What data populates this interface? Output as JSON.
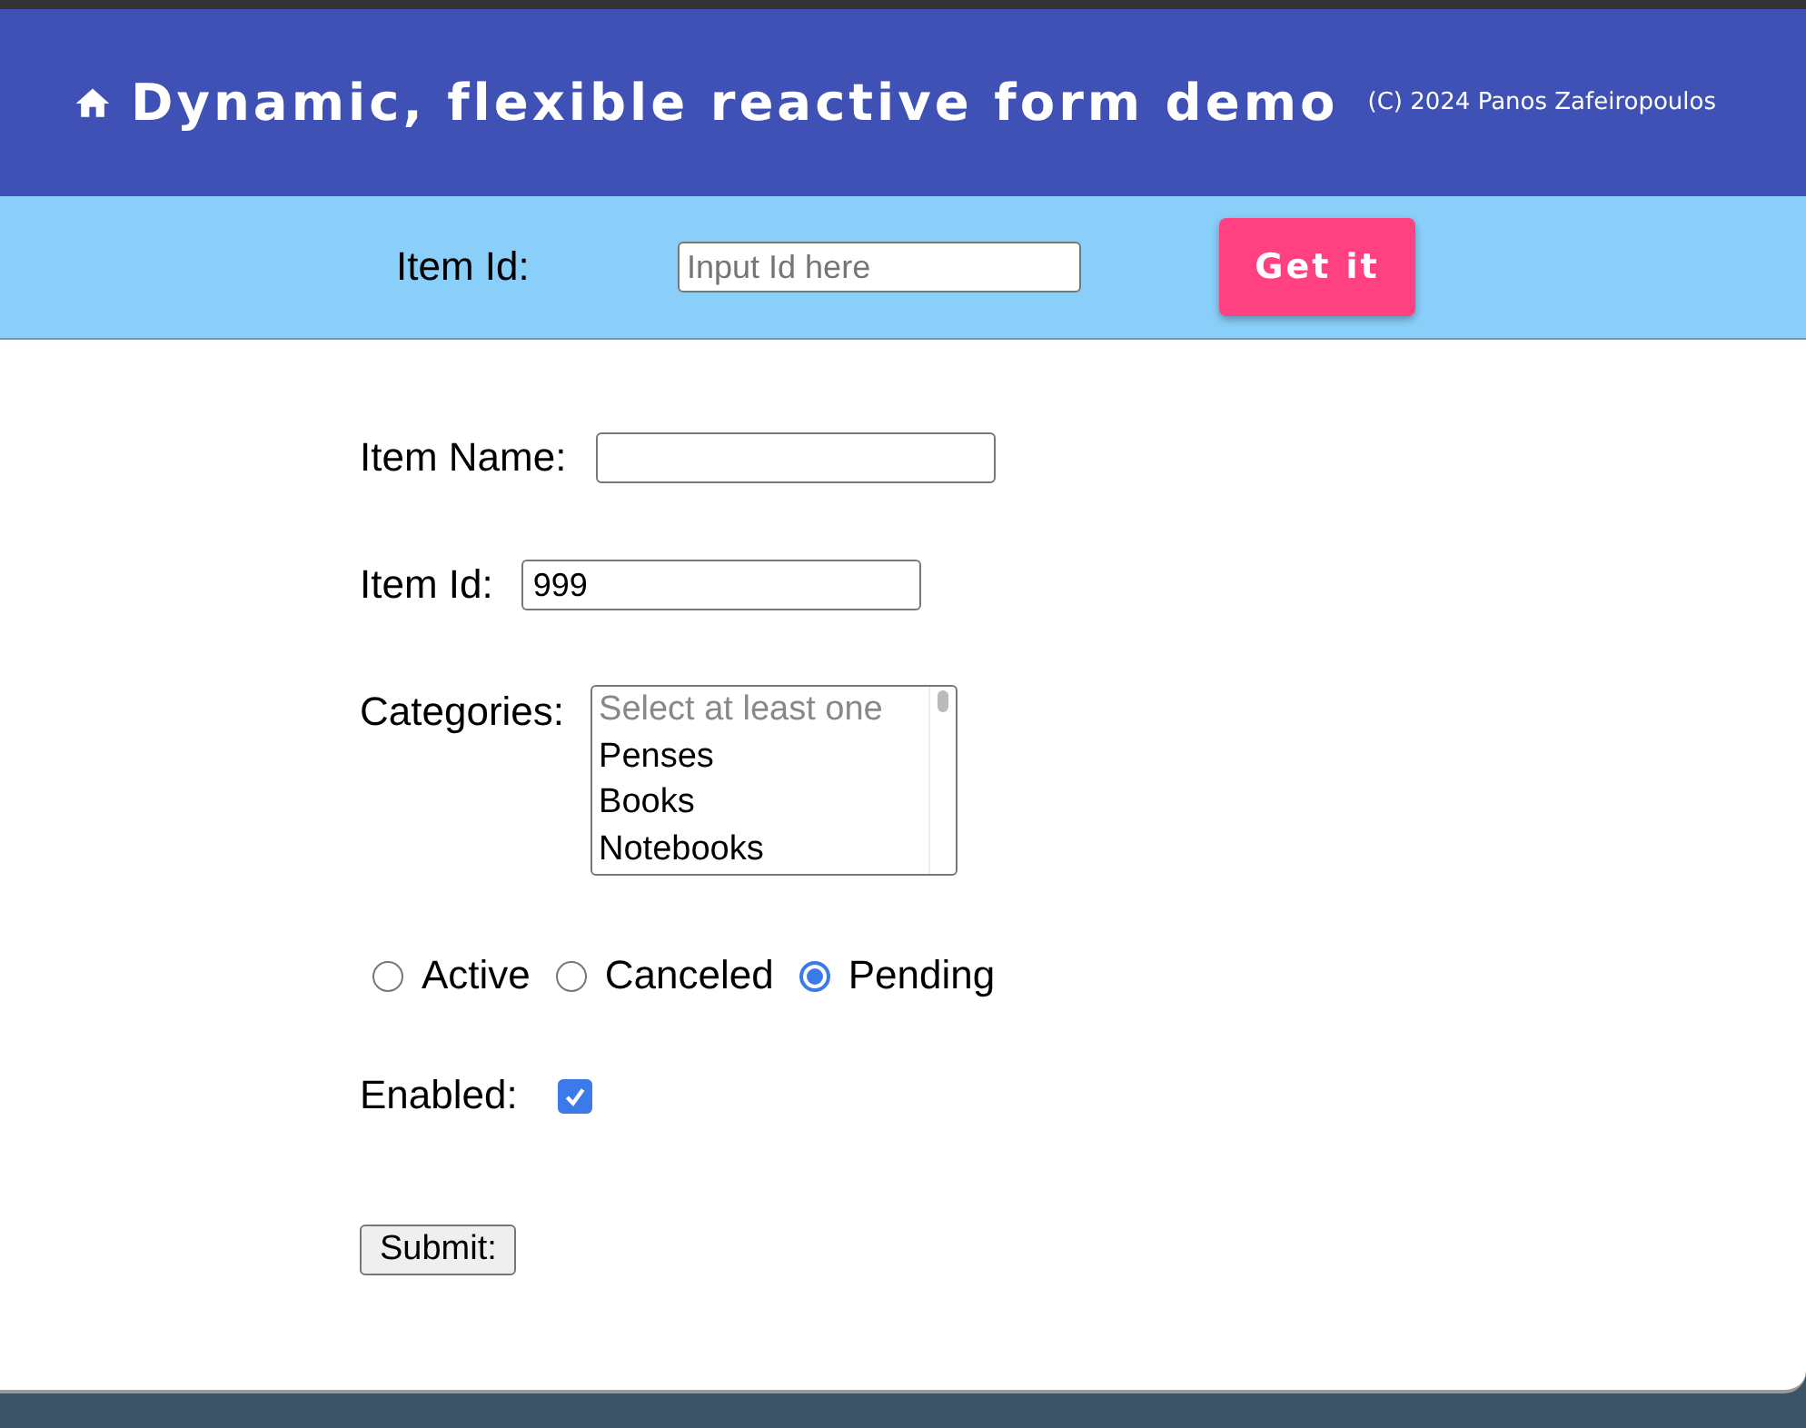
{
  "header": {
    "title": "Dynamic, flexible reactive form demo",
    "copyright": "(C) 2024 Panos Zafeiropoulos"
  },
  "lookup": {
    "label": "Item Id:",
    "placeholder": "Input Id here",
    "button": "Get it"
  },
  "form": {
    "name": {
      "label": "Item Name:"
    },
    "id": {
      "label": "Item Id:",
      "value": "999"
    },
    "categories": {
      "label": "Categories:",
      "options": [
        {
          "label": "Select at least one",
          "kind": "hint"
        },
        {
          "label": "Penses",
          "kind": "option"
        },
        {
          "label": "Books",
          "kind": "option"
        },
        {
          "label": "Notebooks",
          "kind": "option"
        }
      ]
    },
    "status": [
      {
        "label": "Active",
        "selected": false
      },
      {
        "label": "Canceled",
        "selected": false
      },
      {
        "label": "Pending",
        "selected": true
      }
    ],
    "enabled": {
      "label": "Enabled:",
      "checked": true
    },
    "submit": "Submit:"
  }
}
